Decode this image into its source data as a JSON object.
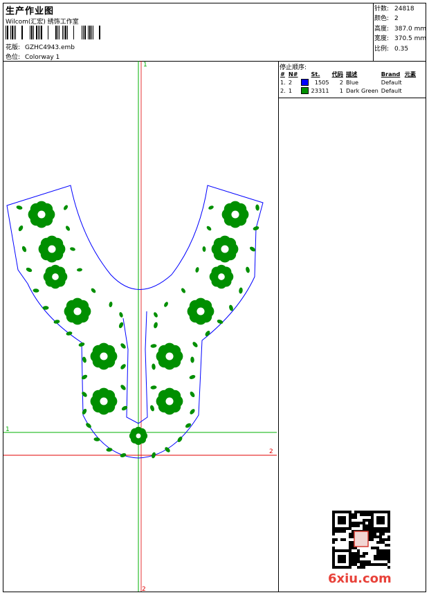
{
  "header": {
    "title": "生产作业图",
    "studio": "Wilcom(汇宏) 绣饰工作室",
    "design_label": "花版:",
    "design_file": "GZHC4943.emb",
    "colorway_label": "色位:",
    "colorway": "Colorway 1"
  },
  "stats": [
    {
      "label": "针数:",
      "value": "24818"
    },
    {
      "label": "颜色:",
      "value": "2"
    },
    {
      "label": "高度:",
      "value": "387.0 mm"
    },
    {
      "label": "宽度:",
      "value": "370.5 mm"
    },
    {
      "label": "比例:",
      "value": "0.35"
    }
  ],
  "stop_sequence": {
    "title": "停止顺序:",
    "columns": [
      "#",
      "N#",
      "St.",
      "代码",
      "描述",
      "Brand",
      "元素"
    ],
    "rows": [
      {
        "idx": "1.",
        "n": "2",
        "color": "#0000ff",
        "st": "1505",
        "code": "2",
        "desc": "Blue",
        "brand": "Default"
      },
      {
        "idx": "2.",
        "n": "1",
        "color": "#008f00",
        "st": "23311",
        "code": "1",
        "desc": "Dark Green",
        "brand": "Default"
      }
    ]
  },
  "axes": {
    "v_top": "1",
    "v_bottom": "2",
    "h_left": "1",
    "h_right": "2"
  },
  "watermark": {
    "text": "6xiu.com"
  },
  "colors": {
    "outline": "#0000ff",
    "fill": "#008f00",
    "axis_green": "#00b000",
    "axis_red": "#e00000"
  }
}
